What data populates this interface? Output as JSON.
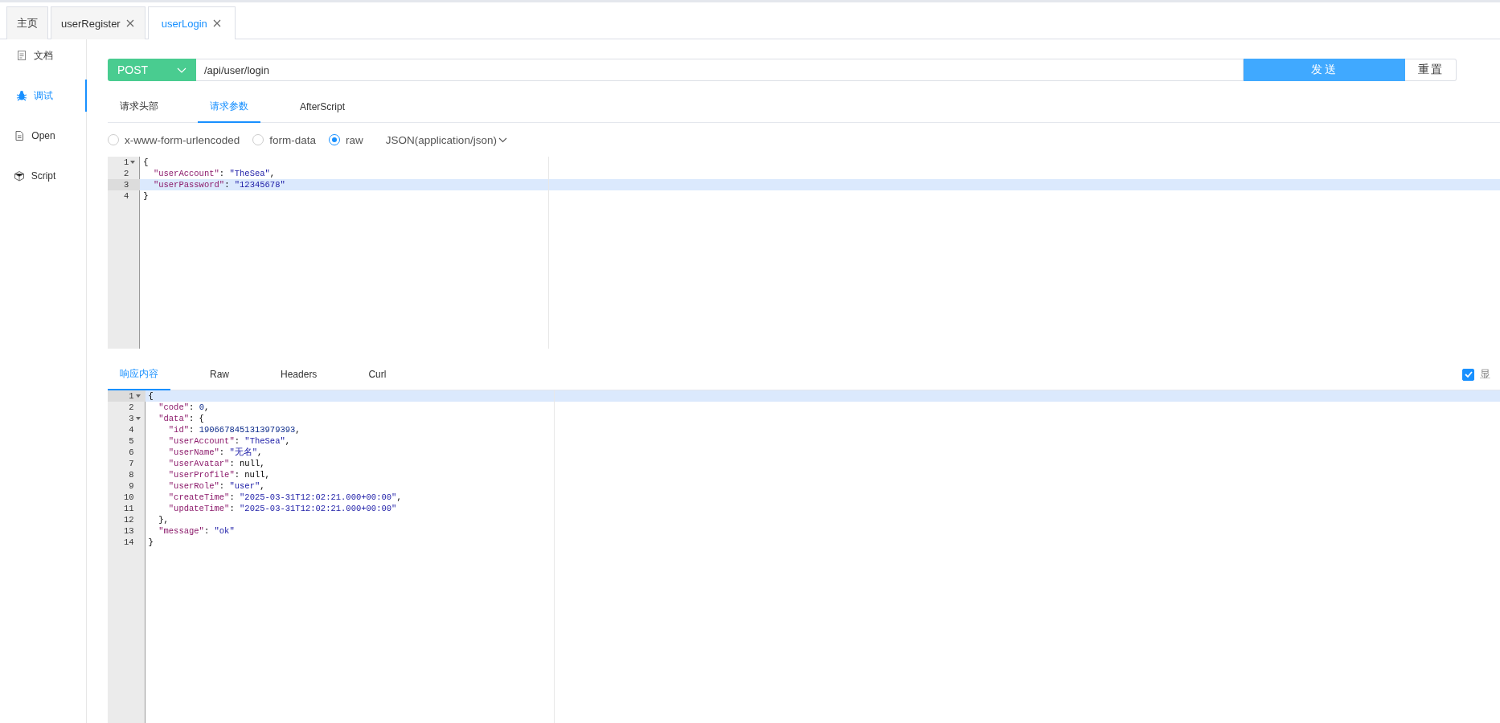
{
  "tabs": [
    {
      "label": "主页",
      "closable": false,
      "selected": false
    },
    {
      "label": "userRegister",
      "closable": true,
      "selected": false
    },
    {
      "label": "userLogin",
      "closable": true,
      "selected": true
    }
  ],
  "sidebar": {
    "items": [
      {
        "label": "文档",
        "selected": false
      },
      {
        "label": "调试",
        "selected": true
      },
      {
        "label": "Open",
        "selected": false
      },
      {
        "label": "Script",
        "selected": false
      }
    ]
  },
  "request": {
    "method": "POST",
    "url": "/api/user/login",
    "send": "发送",
    "reset": "重置"
  },
  "request_tabs": [
    {
      "label": "请求头部",
      "selected": false
    },
    {
      "label": "请求参数",
      "selected": true
    },
    {
      "label": "AfterScript",
      "selected": false
    }
  ],
  "body_types": [
    {
      "label": "x-www-form-urlencoded",
      "selected": false
    },
    {
      "label": "form-data",
      "selected": false
    },
    {
      "label": "raw",
      "selected": true
    }
  ],
  "content_type": "JSON(application/json)",
  "request_body": [
    {
      "number": "1",
      "fold": true,
      "active": false,
      "tokens": [
        {
          "kind": "plain",
          "text": "{"
        }
      ]
    },
    {
      "number": "2",
      "fold": false,
      "active": false,
      "tokens": [
        {
          "kind": "key",
          "text": "  \"userAccount\""
        },
        {
          "kind": "plain",
          "text": ": "
        },
        {
          "kind": "string",
          "text": "\"TheSea\""
        },
        {
          "kind": "plain",
          "text": ","
        }
      ]
    },
    {
      "number": "3",
      "fold": false,
      "active": true,
      "tokens": [
        {
          "kind": "key",
          "text": "  \"userPassword\""
        },
        {
          "kind": "plain",
          "text": ": "
        },
        {
          "kind": "string",
          "text": "\"12345678\""
        }
      ]
    },
    {
      "number": "4",
      "fold": false,
      "active": false,
      "tokens": [
        {
          "kind": "plain",
          "text": "}"
        }
      ]
    }
  ],
  "response_tabs": [
    {
      "label": "响应内容",
      "selected": true
    },
    {
      "label": "Raw",
      "selected": false
    },
    {
      "label": "Headers",
      "selected": false
    },
    {
      "label": "Curl",
      "selected": false
    }
  ],
  "show_option": {
    "label": "显",
    "checked": true
  },
  "response_body": [
    {
      "number": "1",
      "fold": true,
      "active": true,
      "tokens": [
        {
          "kind": "plain",
          "text": "{"
        }
      ]
    },
    {
      "number": "2",
      "fold": false,
      "active": false,
      "tokens": [
        {
          "kind": "key",
          "text": "  \"code\""
        },
        {
          "kind": "plain",
          "text": ": "
        },
        {
          "kind": "number",
          "text": "0"
        },
        {
          "kind": "plain",
          "text": ","
        }
      ]
    },
    {
      "number": "3",
      "fold": true,
      "active": false,
      "tokens": [
        {
          "kind": "key",
          "text": "  \"data\""
        },
        {
          "kind": "plain",
          "text": ": {"
        }
      ]
    },
    {
      "number": "4",
      "fold": false,
      "active": false,
      "tokens": [
        {
          "kind": "key",
          "text": "    \"id\""
        },
        {
          "kind": "plain",
          "text": ": "
        },
        {
          "kind": "number",
          "text": "1906678451313979393"
        },
        {
          "kind": "plain",
          "text": ","
        }
      ]
    },
    {
      "number": "5",
      "fold": false,
      "active": false,
      "tokens": [
        {
          "kind": "key",
          "text": "    \"userAccount\""
        },
        {
          "kind": "plain",
          "text": ": "
        },
        {
          "kind": "string",
          "text": "\"TheSea\""
        },
        {
          "kind": "plain",
          "text": ","
        }
      ]
    },
    {
      "number": "6",
      "fold": false,
      "active": false,
      "tokens": [
        {
          "kind": "key",
          "text": "    \"userName\""
        },
        {
          "kind": "plain",
          "text": ": "
        },
        {
          "kind": "string",
          "text": "\"无名\""
        },
        {
          "kind": "plain",
          "text": ","
        }
      ]
    },
    {
      "number": "7",
      "fold": false,
      "active": false,
      "tokens": [
        {
          "kind": "key",
          "text": "    \"userAvatar\""
        },
        {
          "kind": "plain",
          "text": ": null,"
        }
      ]
    },
    {
      "number": "8",
      "fold": false,
      "active": false,
      "tokens": [
        {
          "kind": "key",
          "text": "    \"userProfile\""
        },
        {
          "kind": "plain",
          "text": ": null,"
        }
      ]
    },
    {
      "number": "9",
      "fold": false,
      "active": false,
      "tokens": [
        {
          "kind": "key",
          "text": "    \"userRole\""
        },
        {
          "kind": "plain",
          "text": ": "
        },
        {
          "kind": "string",
          "text": "\"user\""
        },
        {
          "kind": "plain",
          "text": ","
        }
      ]
    },
    {
      "number": "10",
      "fold": false,
      "active": false,
      "tokens": [
        {
          "kind": "key",
          "text": "    \"createTime\""
        },
        {
          "kind": "plain",
          "text": ": "
        },
        {
          "kind": "string",
          "text": "\"2025-03-31T12:02:21.000+00:00\""
        },
        {
          "kind": "plain",
          "text": ","
        }
      ]
    },
    {
      "number": "11",
      "fold": false,
      "active": false,
      "tokens": [
        {
          "kind": "key",
          "text": "    \"updateTime\""
        },
        {
          "kind": "plain",
          "text": ": "
        },
        {
          "kind": "string",
          "text": "\"2025-03-31T12:02:21.000+00:00\""
        }
      ]
    },
    {
      "number": "12",
      "fold": false,
      "active": false,
      "tokens": [
        {
          "kind": "plain",
          "text": "  },"
        }
      ]
    },
    {
      "number": "13",
      "fold": false,
      "active": false,
      "tokens": [
        {
          "kind": "key",
          "text": "  \"message\""
        },
        {
          "kind": "plain",
          "text": ": "
        },
        {
          "kind": "string",
          "text": "\"ok\""
        }
      ]
    },
    {
      "number": "14",
      "fold": false,
      "active": false,
      "tokens": [
        {
          "kind": "plain",
          "text": "}"
        }
      ]
    }
  ]
}
